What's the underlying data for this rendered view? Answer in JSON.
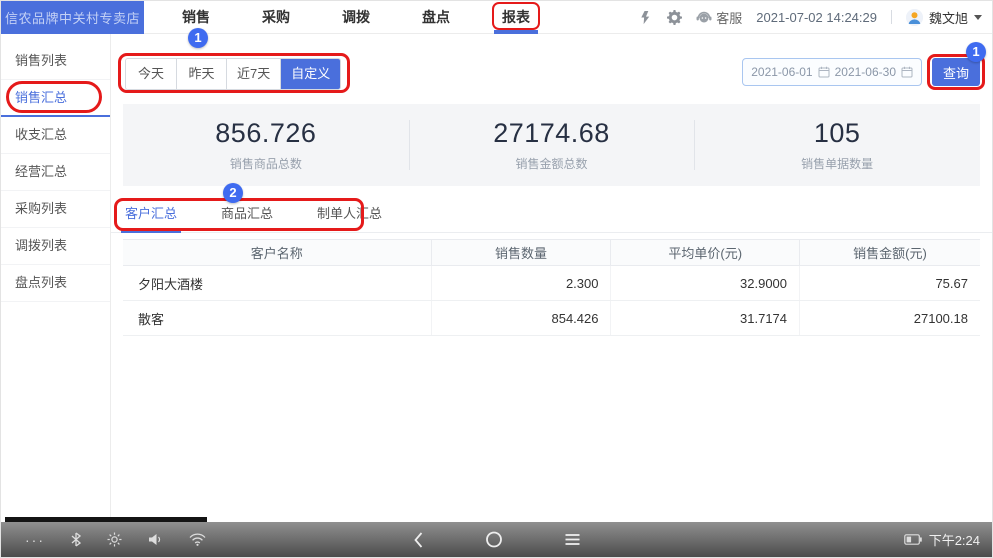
{
  "colors": {
    "primary": "#4a6fdc",
    "annotation_red": "#e51a1a",
    "badge_blue": "#3f6bf0"
  },
  "header": {
    "store_name": "信农品牌中关村专卖店",
    "nav": [
      {
        "label": "销售"
      },
      {
        "label": "采购"
      },
      {
        "label": "调拨"
      },
      {
        "label": "盘点"
      },
      {
        "label": "报表",
        "active": true
      }
    ],
    "customer_service": "客服",
    "datetime": "2021-07-02 14:24:29",
    "username": "魏文旭"
  },
  "sidebar": {
    "items": [
      {
        "label": "销售列表"
      },
      {
        "label": "销售汇总",
        "active": true
      },
      {
        "label": "收支汇总"
      },
      {
        "label": "经营汇总"
      },
      {
        "label": "采购列表"
      },
      {
        "label": "调拨列表"
      },
      {
        "label": "盘点列表"
      }
    ]
  },
  "filters": {
    "buttons": [
      {
        "label": "今天"
      },
      {
        "label": "昨天"
      },
      {
        "label": "近7天"
      },
      {
        "label": "自定义",
        "selected": true
      }
    ],
    "date_start": "2021-06-01",
    "date_end": "2021-06-30",
    "query_label": "查询"
  },
  "stats": [
    {
      "value": "856.726",
      "label": "销售商品总数"
    },
    {
      "value": "27174.68",
      "label": "销售金额总数"
    },
    {
      "value": "105",
      "label": "销售单据数量"
    }
  ],
  "tabs": [
    {
      "label": "客户汇总",
      "active": true
    },
    {
      "label": "商品汇总"
    },
    {
      "label": "制单人汇总"
    }
  ],
  "table": {
    "columns": [
      "客户名称",
      "销售数量",
      "平均单价(元)",
      "销售金额(元)"
    ],
    "rows": [
      {
        "name": "夕阳大酒楼",
        "qty": "2.300",
        "avg_price": "32.9000",
        "amount": "75.67"
      },
      {
        "name": "散客",
        "qty": "854.426",
        "avg_price": "31.7174",
        "amount": "27100.18"
      }
    ]
  },
  "annotations": {
    "badge_filters": "1",
    "badge_query": "1",
    "badge_tabs": "2"
  },
  "statusbar": {
    "time": "下午2:24"
  }
}
